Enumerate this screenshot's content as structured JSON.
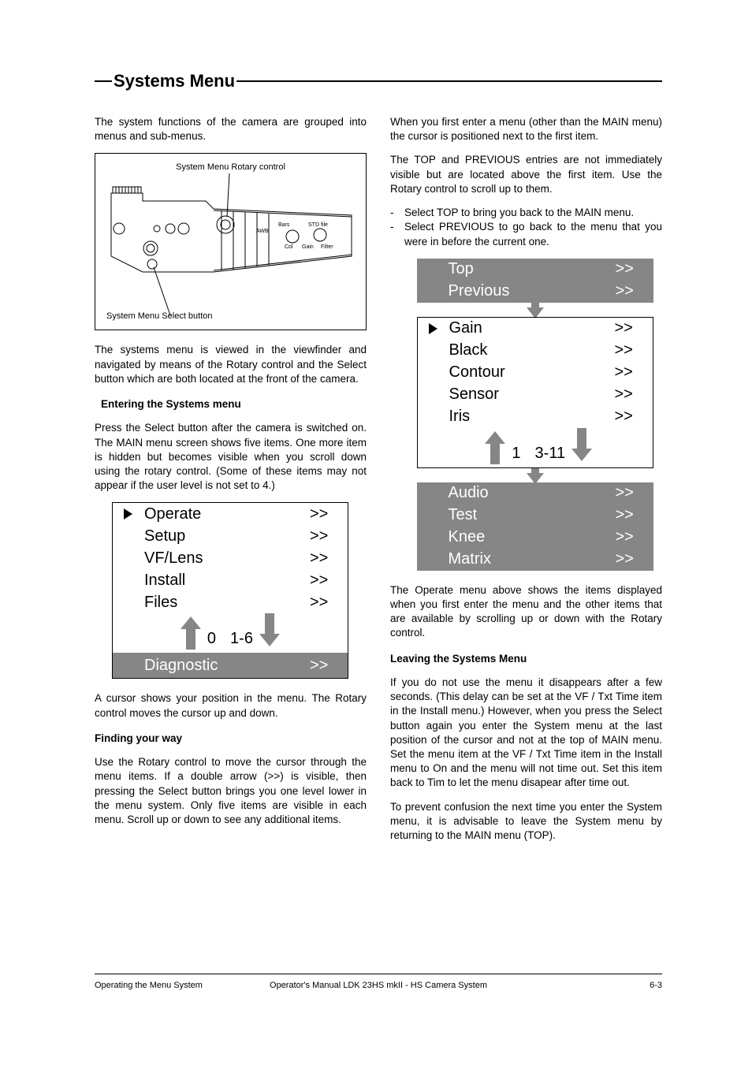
{
  "title": "Systems Menu",
  "left_col": {
    "intro": "The system functions of the camera are grouped into menus and sub-menus.",
    "diagram": {
      "label_top": "System Menu Rotary control",
      "label_bottom": "System Menu Select button"
    },
    "p_after_diagram": "The systems menu is viewed in the viewfinder and navigated by means of the Rotary control and the Select button which are both located at the front of the camera.",
    "h_entering": "Entering the Systems menu",
    "p_entering": "Press the Select button after the camera is switched on. The MAIN menu screen shows five items.  One more item is hidden but becomes visible when you scroll down using the rotary control.  (Some of these items may not appear if the user level is not set to 4.)",
    "main_menu": {
      "items": [
        {
          "label": "Operate",
          "arr": ">>",
          "cursor": true
        },
        {
          "label": "Setup",
          "arr": ">>"
        },
        {
          "label": "VF/Lens",
          "arr": ">>"
        },
        {
          "label": "Install",
          "arr": ">>"
        },
        {
          "label": "Files",
          "arr": ">>"
        }
      ],
      "page_from": "0",
      "page_to": "1-6",
      "hidden": {
        "label": "Diagnostic",
        "arr": ">>"
      }
    },
    "p_cursor": "A cursor shows your position in the menu. The Rotary control moves the cursor up and down.",
    "h_finding": "Finding your way",
    "p_finding": "Use the Rotary control to move the cursor through the menu items. If a double arrow (>>) is visible, then pressing the Select button brings you one level lower in the menu system. Only five items are visible in each menu. Scroll up or down to see any additional items."
  },
  "right_col": {
    "p_enter": "When you first enter a menu (other than the MAIN menu) the cursor is positioned next to the first item.",
    "p_topprev": " The TOP and PREVIOUS entries are not immediately visible but are located above the first item. Use the Rotary control to scroll up to them.",
    "bullets": [
      "Select TOP to bring you back to the MAIN menu.",
      "Select PREVIOUS to go back to the menu that you were in before the current one."
    ],
    "hidden_above": [
      {
        "label": "Top",
        "arr": ">>"
      },
      {
        "label": "Previous",
        "arr": ">>"
      }
    ],
    "visible_menu": {
      "items": [
        {
          "label": "Gain",
          "arr": ">>",
          "cursor": true
        },
        {
          "label": "Black",
          "arr": ">>"
        },
        {
          "label": "Contour",
          "arr": ">>"
        },
        {
          "label": "Sensor",
          "arr": ">>"
        },
        {
          "label": "Iris",
          "arr": ">>"
        }
      ],
      "page_from": "1",
      "page_to": "3-11"
    },
    "hidden_below": [
      {
        "label": "Audio",
        "arr": ">>"
      },
      {
        "label": "Test",
        "arr": ">>"
      },
      {
        "label": "Knee",
        "arr": ">>"
      },
      {
        "label": "Matrix",
        "arr": ">>"
      }
    ],
    "p_operate": "The Operate menu above shows the items displayed when you first enter the menu and the other items that are available by scrolling up or down with the Rotary control.",
    "h_leaving": "Leaving the Systems Menu",
    "p_leaving1": "If you do not use the menu it disappears after a few seconds. (This delay can be set at the VF / Txt Time item in the Install menu.) However, when you press the Select button again you enter the System menu at the last position of the cursor and not at the top of MAIN menu. Set the menu item at the VF / Txt Time item in the Install menu to On and the menu will not time out. Set this  item back to Tim to let the menu disapear after time out.",
    "p_leaving2": "To prevent confusion the next time you enter the System menu, it is advisable to leave the System menu by returning to the MAIN menu (TOP)."
  },
  "footer": {
    "left": "Operating the Menu System",
    "center": "Operator's Manual LDK 23HS mkII - HS Camera System",
    "right": "6-3"
  }
}
